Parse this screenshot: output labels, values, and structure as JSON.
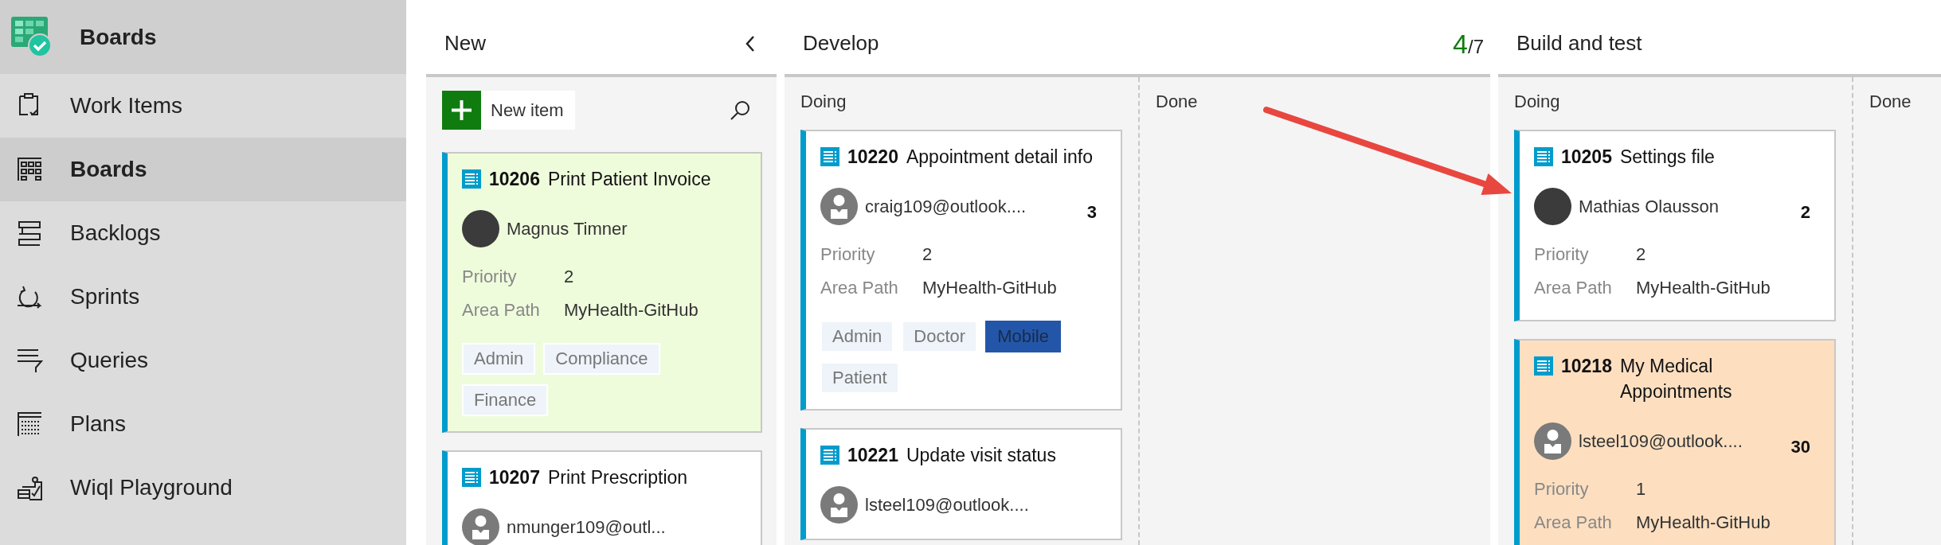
{
  "sidebar": {
    "header": {
      "label": "Boards"
    },
    "items": [
      {
        "label": "Work Items",
        "selected": false
      },
      {
        "label": "Boards",
        "selected": true
      },
      {
        "label": "Backlogs",
        "selected": false
      },
      {
        "label": "Sprints",
        "selected": false
      },
      {
        "label": "Queries",
        "selected": false
      },
      {
        "label": "Plans",
        "selected": false
      },
      {
        "label": "Wiql Playground",
        "selected": false
      }
    ]
  },
  "board": {
    "columns": [
      {
        "title": "New",
        "new_item_button": {
          "label": "New item"
        },
        "cards": [
          {
            "id": "10206",
            "title": "Print Patient Invoice",
            "color": "#effcdc",
            "assignee": {
              "name": "Magnus Timner",
              "kind": "photo"
            },
            "fields": [
              {
                "label": "Priority",
                "value": "2"
              },
              {
                "label": "Area Path",
                "value": "MyHealth-GitHub"
              }
            ],
            "tags": [
              {
                "label": "Admin",
                "color": "#eef4fa"
              },
              {
                "label": "Compliance",
                "color": "#eef4fa"
              },
              {
                "label": "Finance",
                "color": "#eef4fa"
              }
            ]
          },
          {
            "id": "10207",
            "title": "Print Prescription",
            "color": "#ffffff",
            "assignee": {
              "name": "nmunger109@outl...",
              "kind": "generic"
            }
          }
        ]
      },
      {
        "title": "Develop",
        "wip_count": "4",
        "wip_limit": "/7",
        "lanes": [
          {
            "title": "Doing",
            "cards": [
              {
                "id": "10220",
                "title": "Appointment detail info",
                "color": "#ffffff",
                "assignee": {
                  "name": "craig109@outlook....",
                  "kind": "generic"
                },
                "effort": "3",
                "fields": [
                  {
                    "label": "Priority",
                    "value": "2"
                  },
                  {
                    "label": "Area Path",
                    "value": "MyHealth-GitHub"
                  }
                ],
                "tags": [
                  {
                    "label": "Admin",
                    "color": "#eef4fa"
                  },
                  {
                    "label": "Doctor",
                    "color": "#eef4fa"
                  },
                  {
                    "label": "Mobile",
                    "color": "#2356a8"
                  },
                  {
                    "label": "Patient",
                    "color": "#eef4fa"
                  }
                ]
              },
              {
                "id": "10221",
                "title": "Update visit status",
                "color": "#ffffff",
                "assignee": {
                  "name": "lsteel109@outlook....",
                  "kind": "generic"
                }
              }
            ]
          },
          {
            "title": "Done"
          }
        ]
      },
      {
        "title": "Build and test",
        "lanes": [
          {
            "title": "Doing",
            "cards": [
              {
                "id": "10205",
                "title": "Settings file",
                "color": "#ffffff",
                "assignee": {
                  "name": "Mathias Olausson",
                  "kind": "photo"
                },
                "effort": "2",
                "fields": [
                  {
                    "label": "Priority",
                    "value": "2"
                  },
                  {
                    "label": "Area Path",
                    "value": "MyHealth-GitHub"
                  }
                ]
              },
              {
                "id": "10218",
                "title": "My Medical Appointments",
                "color": "#fddfc0",
                "assignee": {
                  "name": "lsteel109@outlook....",
                  "kind": "generic"
                },
                "effort": "30",
                "fields": [
                  {
                    "label": "Priority",
                    "value": "1"
                  },
                  {
                    "label": "Area Path",
                    "value": "MyHealth-GitHub"
                  }
                ]
              }
            ]
          },
          {
            "title": "Done"
          }
        ]
      }
    ]
  }
}
